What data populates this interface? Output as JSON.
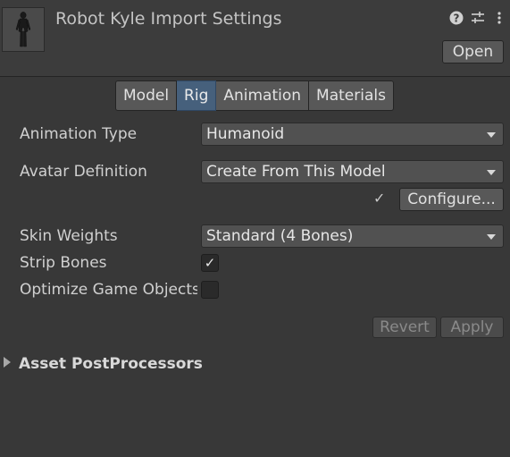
{
  "header": {
    "title": "Robot Kyle Import Settings",
    "open_label": "Open",
    "icons": [
      "help-icon",
      "presets-icon",
      "more-options-icon"
    ]
  },
  "tabs": [
    {
      "label": "Model",
      "active": false
    },
    {
      "label": "Rig",
      "active": true
    },
    {
      "label": "Animation",
      "active": false
    },
    {
      "label": "Materials",
      "active": false
    }
  ],
  "rig": {
    "animation_type": {
      "label": "Animation Type",
      "value": "Humanoid"
    },
    "avatar_definition": {
      "label": "Avatar Definition",
      "value": "Create From This Model"
    },
    "configure": {
      "check": "✓",
      "button_label": "Configure..."
    },
    "skin_weights": {
      "label": "Skin Weights",
      "value": "Standard (4 Bones)"
    },
    "strip_bones": {
      "label": "Strip Bones",
      "checked": true,
      "check": "✓"
    },
    "optimize_game_objects": {
      "label": "Optimize Game Objects",
      "checked": false
    }
  },
  "footer_buttons": {
    "revert_label": "Revert",
    "apply_label": "Apply"
  },
  "foldout": {
    "label": "Asset PostProcessors",
    "expanded": false
  },
  "colors": {
    "background": "#383838",
    "active_tab": "#46607c",
    "button": "#585858"
  }
}
